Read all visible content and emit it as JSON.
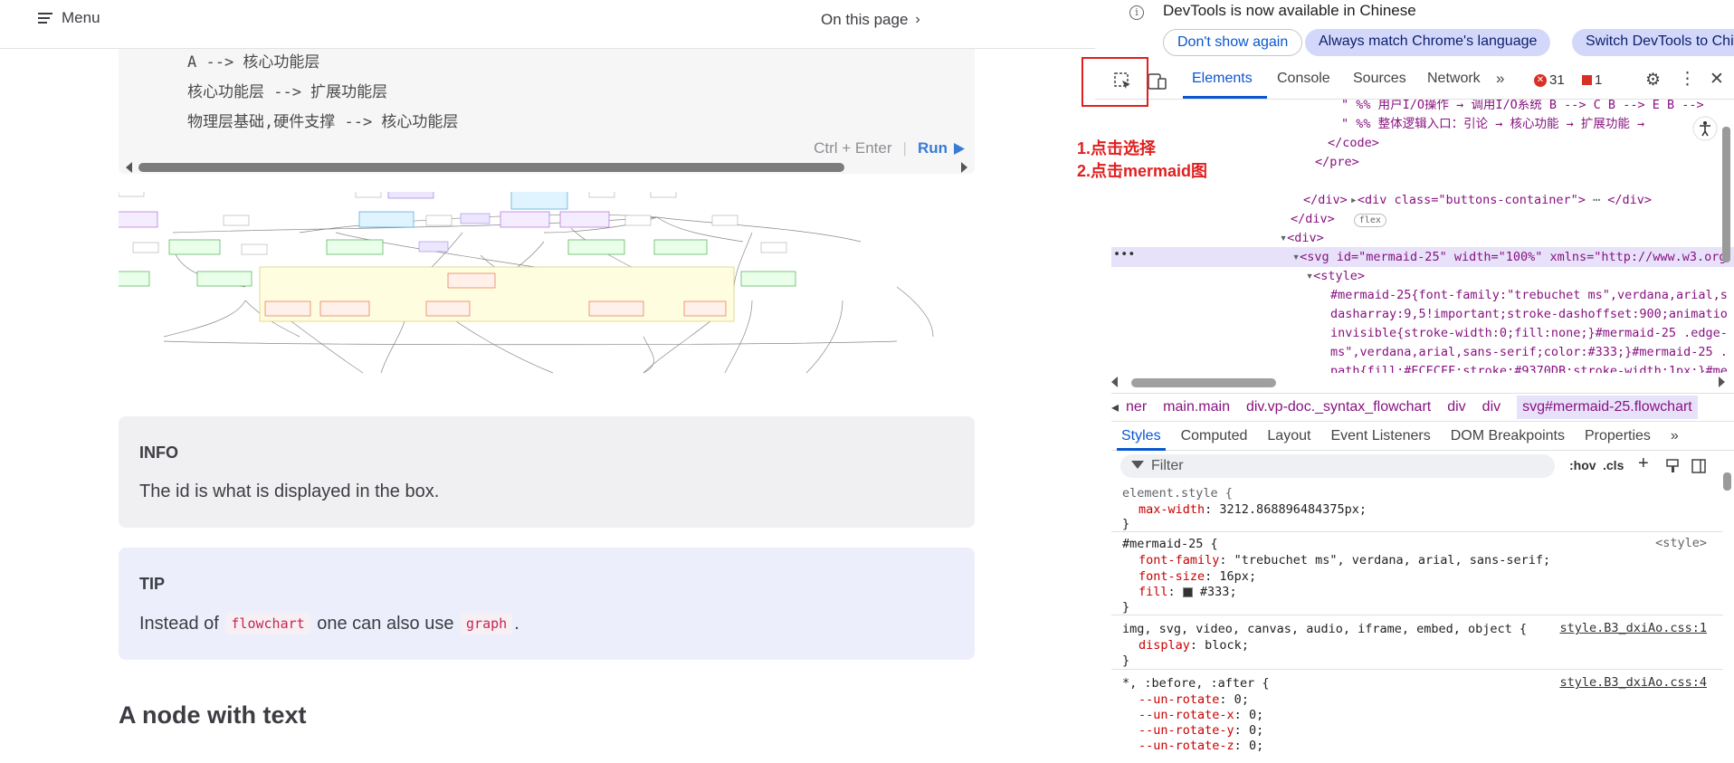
{
  "topbar": {
    "menu_label": "Menu",
    "on_this_page": "On this page"
  },
  "code": {
    "lines": [
      "A --> 核心功能层",
      "核心功能层 --> 扩展功能层",
      "物理层基础,硬件支撑 --> 核心功能层"
    ],
    "hint": "Ctrl + Enter",
    "run_label": "Run"
  },
  "info": {
    "title": "INFO",
    "text": "The id is what is displayed in the box."
  },
  "tip": {
    "title": "TIP",
    "before": "Instead of ",
    "code1": "flowchart",
    "middle": " one can also use ",
    "code2": "graph",
    "after": "."
  },
  "heading": "A node with text",
  "annotation": {
    "step1": "1.点击选择",
    "step2": "2.点击mermaid图"
  },
  "devtools": {
    "banner_message": "DevTools is now available in Chinese",
    "btn_dont_show": "Don't show again",
    "btn_always_match": "Always match Chrome's language",
    "btn_switch": "Switch DevTools to Chinese",
    "tabs": [
      "Elements",
      "Console",
      "Sources",
      "Network"
    ],
    "errors": "31",
    "warnings": "1",
    "elements": {
      "l1": "\" %% 用户I/O操作 → 调用I/O系统 B --> C B --> E B -->",
      "l2": "\" %% 整体逻辑入口：引论 → 核心功能 → 扩展功能 →",
      "l3": "</code>",
      "l4": "</pre>",
      "l5_tag": "<div class=\"buttons-container\">",
      "l5_end": "</div>",
      "l5_badge": "flex",
      "l6": "</div>",
      "l7": "</div>",
      "l8": "<div>",
      "l9_tag": "<svg id=\"mermaid-25\" width=\"100%\" xmlns=\"http://www.w3.org",
      "l10": "<style>",
      "l11": "#mermaid-25{font-family:\"trebuchet ms\",verdana,arial,s",
      "l12": "dasharray:9,5!important;stroke-dashoffset:900;animatio",
      "l13": "invisible{stroke-width:0;fill:none;}#mermaid-25 .edge-",
      "l14": "ms\",verdana,arial,sans-serif;color:#333;}#mermaid-25 .",
      "l15": "path{fill:#ECECFF;stroke:#9370DB;stroke-width:1px;}#me"
    },
    "breadcrumbs": [
      "ner",
      "main.main",
      "div.vp-doc._syntax_flowchart",
      "div",
      "div",
      "svg#mermaid-25.flowchart"
    ],
    "subtabs": [
      "Styles",
      "Computed",
      "Layout",
      "Event Listeners",
      "DOM Breakpoints",
      "Properties"
    ],
    "filter_placeholder": "Filter",
    "hov": ":hov",
    "cls": ".cls",
    "styles": {
      "r1_sel": "element.style {",
      "r1_p1": "max-width",
      "r1_v1": "3212.868896484375px",
      "r2_sel": "#mermaid-25 {",
      "r2_src": "<style>",
      "r2_p1": "font-family",
      "r2_v1": "\"trebuchet ms\", verdana, arial, sans-serif",
      "r2_p2": "font-size",
      "r2_v2": "16px",
      "r2_p3": "fill",
      "r2_v3": "#333",
      "r3_sel": "img, svg, video, canvas, audio, iframe, embed, object {",
      "r3_src": "style.B3_dxiAo.css:1",
      "r3_p1": "display",
      "r3_v1": "block",
      "r4_sel": "*, :before, :after {",
      "r4_src": "style.B3_dxiAo.css:4",
      "r4_p1": "--un-rotate",
      "r4_p2": "--un-rotate-x",
      "r4_p3": "--un-rotate-y",
      "r4_p4": "--un-rotate-z",
      "r4_v": "0",
      "close": "}"
    }
  },
  "colors": {
    "accent": "#0b57d0",
    "annotation": "#e02020",
    "run": "#3a7bd5",
    "tip_bg": "#edeefb",
    "info_bg": "#f0f0f2"
  }
}
